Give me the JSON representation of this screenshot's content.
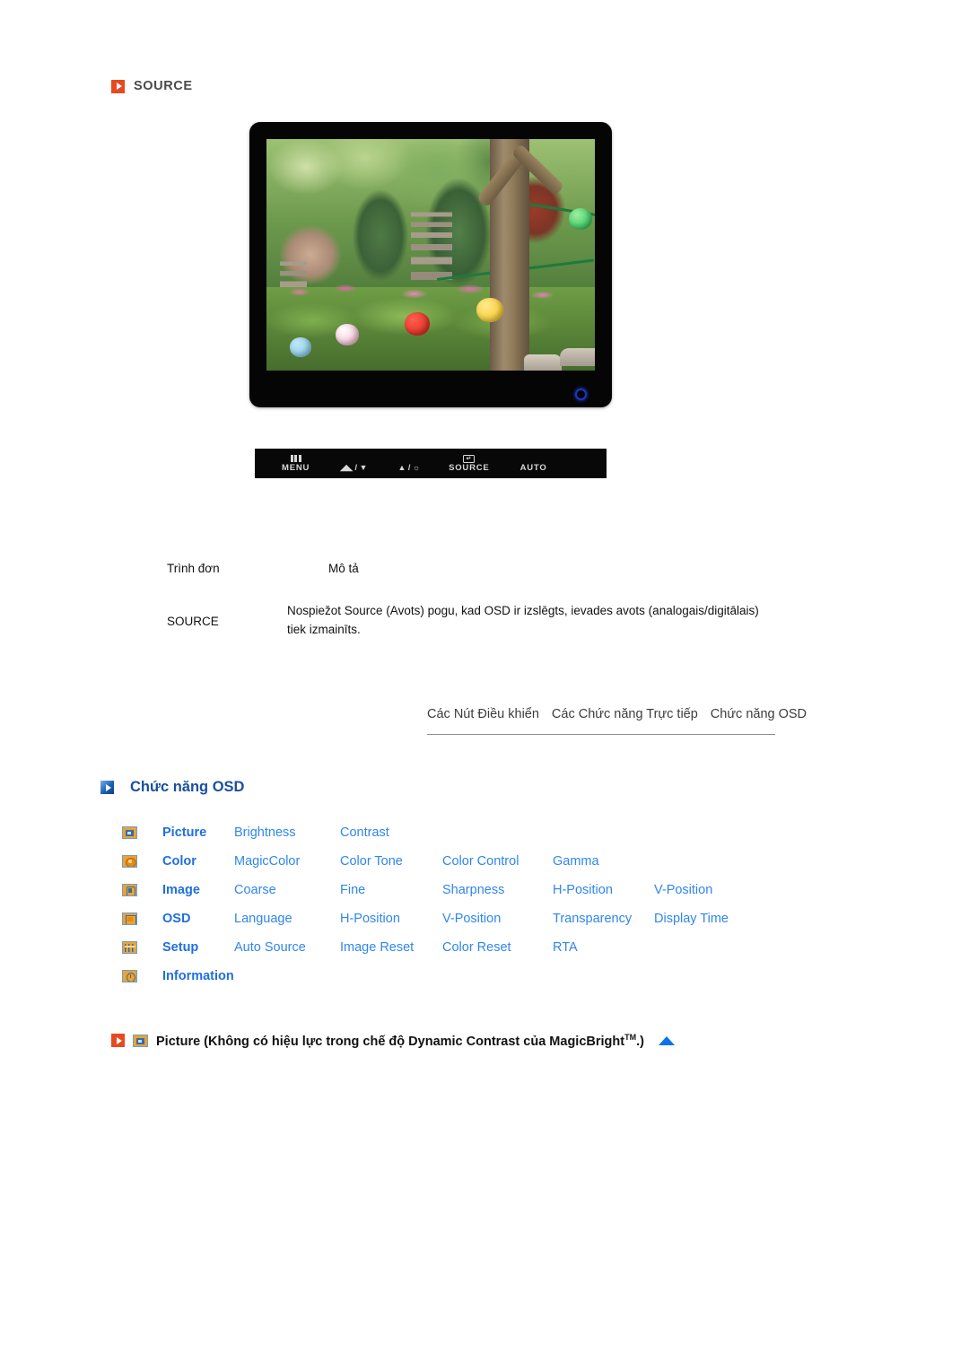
{
  "source_section": {
    "icon": "orange-play-icon",
    "title": "SOURCE"
  },
  "monitor": {
    "name": "lcd-monitor-illustration",
    "power_led": "power-led-indicator",
    "screen_scene": "garden-with-stone-pagodas-and-lanterns",
    "control_buttons": [
      {
        "icon": "menu-grid-icon",
        "label": "MENU"
      },
      {
        "icon": "brightness-down-icon",
        "label": "◢◣ / ▼"
      },
      {
        "icon": "brightness-up-icon",
        "label": "▲ / ☼"
      },
      {
        "icon": "return-enter-icon",
        "label": "SOURCE"
      },
      {
        "icon": "auto-adjust-icon",
        "label": "AUTO"
      }
    ]
  },
  "description_table": {
    "headers": {
      "menu": "Trình đơn",
      "description": "Mô tả"
    },
    "rows": [
      {
        "menu": "SOURCE",
        "description": "Nospiežot Source (Avots) pogu, kad OSD ir izslēgts, ievades avots (analogais/digitālais) tiek izmainīts."
      }
    ]
  },
  "subnav": {
    "links": [
      "Các Nút Điều khiển",
      "Các Chức năng Trực tiếp",
      "Chức năng OSD"
    ]
  },
  "osd_section": {
    "icon": "blue-play-icon",
    "title": "Chức năng OSD",
    "rows": [
      {
        "icon": "picture-icon",
        "category": "Picture",
        "items": [
          "Brightness",
          "Contrast"
        ]
      },
      {
        "icon": "color-icon",
        "category": "Color",
        "items": [
          "MagicColor",
          "Color Tone",
          "Color Control",
          "Gamma"
        ]
      },
      {
        "icon": "image-icon",
        "category": "Image",
        "items": [
          "Coarse",
          "Fine",
          "Sharpness",
          "H-Position",
          "V-Position"
        ]
      },
      {
        "icon": "osd-icon",
        "category": "OSD",
        "items": [
          "Language",
          "H-Position",
          "V-Position",
          "Transparency",
          "Display Time"
        ]
      },
      {
        "icon": "setup-icon",
        "category": "Setup",
        "items": [
          "Auto Source",
          "Image Reset",
          "Color Reset",
          "RTA"
        ]
      },
      {
        "icon": "information-icon",
        "category": "Information",
        "items": []
      }
    ]
  },
  "picture_heading": {
    "bullet_icon": "orange-play-icon",
    "category_icon": "picture-icon",
    "text_before": "Picture (Không có hiệu lực trong chế độ Dynamic Contrast của MagicBright",
    "trademark": "TM",
    "text_after": ".)",
    "back_to_top_icon": "blue-up-triangle-icon"
  },
  "colors": {
    "orange_accent": "#e8491f",
    "blue_heading": "#1a4fa0",
    "blue_category": "#1f6fe0",
    "blue_item": "#2f86f0",
    "icon_orange": "#f0a22a",
    "led_blue": "#1a35c8"
  }
}
